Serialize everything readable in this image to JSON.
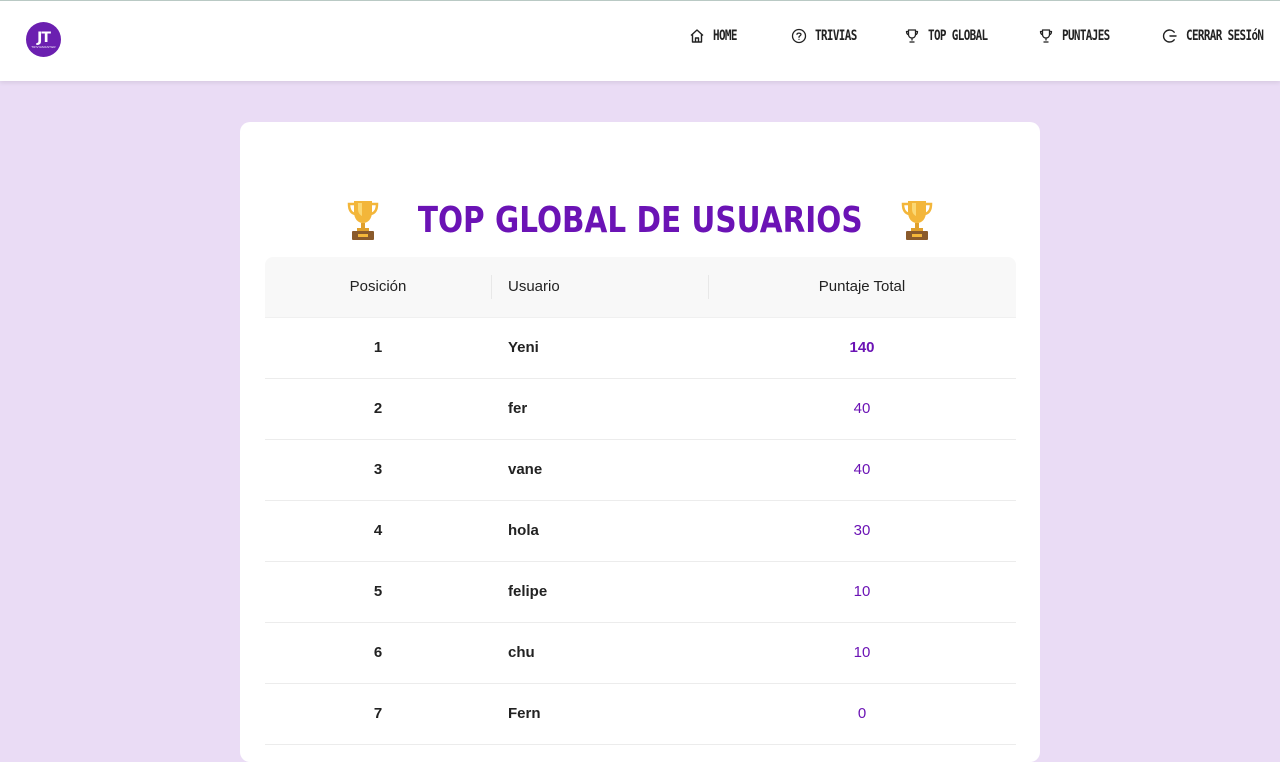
{
  "nav": {
    "logo_text": "TRIVIAMASTER",
    "logo_mark": "JT",
    "items": [
      {
        "label": "HOME",
        "icon": "home-icon"
      },
      {
        "label": "TRIVIAS",
        "icon": "question-circle-icon"
      },
      {
        "label": "TOP GLOBAL",
        "icon": "trophy-icon"
      },
      {
        "label": "PUNTAJES",
        "icon": "trophy-icon"
      },
      {
        "label": "CERRAR SESIóN",
        "icon": "logout-icon"
      }
    ]
  },
  "ranking": {
    "title": "TOP GLOBAL DE USUARIOS",
    "title_icon": "trophy-emoji",
    "columns": [
      "Posición",
      "Usuario",
      "Puntaje Total"
    ],
    "rows": [
      {
        "pos": "1",
        "user": "Yeni",
        "score": "140"
      },
      {
        "pos": "2",
        "user": "fer",
        "score": "40"
      },
      {
        "pos": "3",
        "user": "vane",
        "score": "40"
      },
      {
        "pos": "4",
        "user": "hola",
        "score": "30"
      },
      {
        "pos": "5",
        "user": "felipe",
        "score": "10"
      },
      {
        "pos": "6",
        "user": "chu",
        "score": "10"
      },
      {
        "pos": "7",
        "user": "Fern",
        "score": "0"
      }
    ]
  },
  "colors": {
    "accent": "#6b13b5",
    "background": "#eadcf5",
    "card": "#ffffff"
  }
}
